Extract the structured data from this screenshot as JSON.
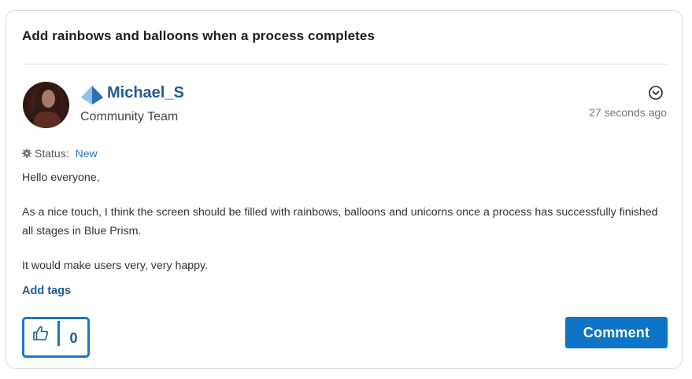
{
  "post": {
    "title": "Add rainbows and balloons when a process completes",
    "author": {
      "name": "Michael_S",
      "role": "Community Team"
    },
    "timestamp": "27 seconds ago",
    "status": {
      "label": "Status:",
      "value": "New"
    },
    "body": [
      "Hello everyone,",
      "As a nice touch, I think the screen should be filled with rainbows, balloons and unicorns once a process has successfully finished all stages in Blue Prism.",
      "It would make users very, very happy."
    ],
    "add_tags_label": "Add tags",
    "kudos_count": "0",
    "comment_label": "Comment"
  },
  "icons": {
    "rank": "blue-diamond-rank-icon",
    "options": "chevron-down-circle-icon",
    "status": "gear-icon",
    "kudos": "thumbs-up-icon"
  },
  "colors": {
    "accent": "#0d74c8",
    "link": "#1f5d95",
    "status_link": "#2b79c2"
  }
}
